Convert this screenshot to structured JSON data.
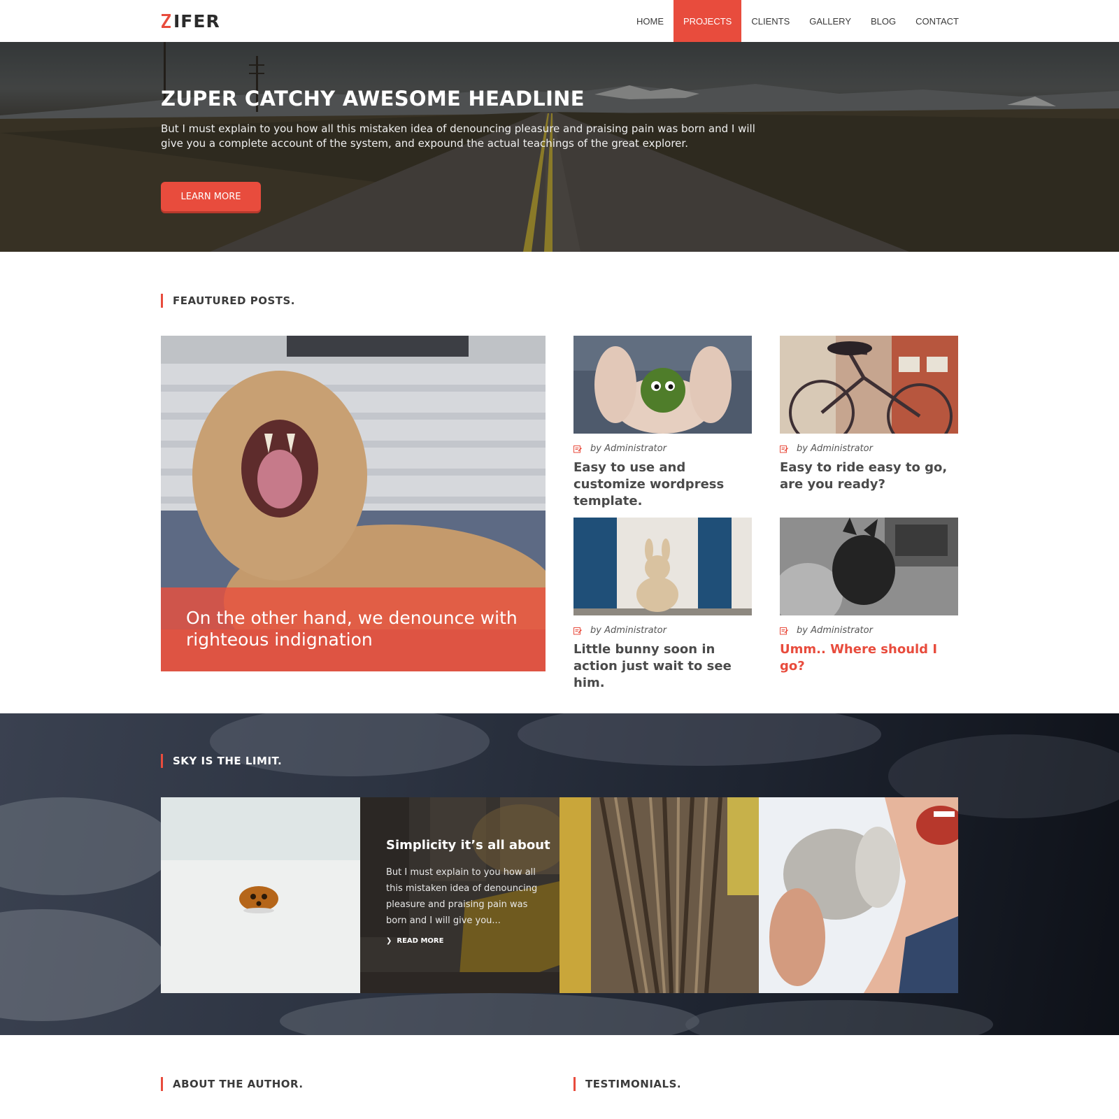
{
  "header": {
    "logo": "IFER",
    "nav": [
      {
        "label": "HOME",
        "active": false
      },
      {
        "label": "PROJECTS",
        "active": true
      },
      {
        "label": "CLIENTS",
        "active": false
      },
      {
        "label": "GALLERY",
        "active": false
      },
      {
        "label": "BLOG",
        "active": false
      },
      {
        "label": "CONTACT",
        "active": false
      }
    ]
  },
  "hero": {
    "title": "ZUPER CATCHY AWESOME HEADLINE",
    "text": "But I must explain to you how all this mistaken idea of denouncing pleasure and praising pain was born and I will give you a complete account of the system, and expound the actual teachings of the great explorer.",
    "button": "LEARN MORE"
  },
  "featured": {
    "heading": "FEAUTURED POSTS.",
    "main_caption": "On the other hand, we denounce with righteous indignation",
    "posts": [
      {
        "author": "by Administrator",
        "title": "Easy to use and customize wordpress template."
      },
      {
        "author": "by Administrator",
        "title": "Easy to ride easy to go, are you ready?"
      },
      {
        "author": "by Administrator",
        "title": "Little bunny soon in action just wait to see him."
      },
      {
        "author": "by Administrator",
        "title": "Umm.. Where should I go?"
      }
    ]
  },
  "sky": {
    "heading": "SKY IS THE LIMIT.",
    "tile": {
      "title": "Simplicity it’s all about",
      "text": "But I must explain to you how all this mistaken idea of denouncing pleasure and praising pain was born and I will give you...",
      "link": "READ MORE"
    }
  },
  "bottom": {
    "about_heading": "ABOUT THE AUTHOR.",
    "testimonials_heading": "TESTIMONIALS."
  },
  "colors": {
    "accent": "#e84c3d",
    "text_dark": "#3b3b3b"
  }
}
